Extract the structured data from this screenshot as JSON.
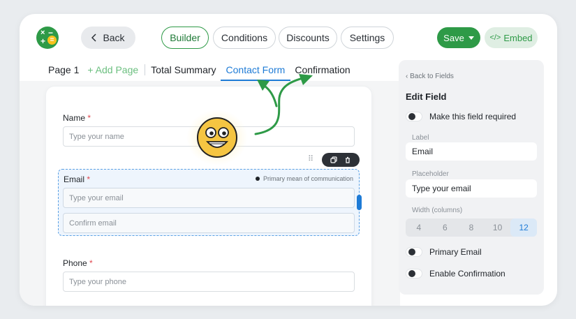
{
  "topbar": {
    "back_label": "Back",
    "tabs": [
      "Builder",
      "Conditions",
      "Discounts",
      "Settings"
    ],
    "save_label": "Save",
    "embed_label": "Embed"
  },
  "pages": {
    "page1": "Page 1",
    "add_page": "+ Add Page",
    "summary": "Total Summary",
    "contact": "Contact Form",
    "confirmation": "Confirmation"
  },
  "form": {
    "name_label": "Name",
    "name_placeholder": "Type your name",
    "email_label": "Email",
    "email_placeholder": "Type your email",
    "confirm_placeholder": "Confirm email",
    "primary_note": "Primary mean of communication",
    "phone_label": "Phone",
    "phone_placeholder": "Type your phone",
    "required_mark": "*"
  },
  "panel": {
    "back": "Back to Fields",
    "title": "Edit Field",
    "required_toggle": "Make this field required",
    "label_caption": "Label",
    "label_value": "Email",
    "placeholder_caption": "Placeholder",
    "placeholder_value": "Type your email",
    "width_caption": "Width (columns)",
    "widths": [
      "4",
      "6",
      "8",
      "10",
      "12"
    ],
    "width_selected": "12",
    "primary_toggle": "Primary Email",
    "confirm_toggle": "Enable Confirmation"
  },
  "colors": {
    "accent_green": "#2e9a47",
    "accent_blue": "#1e7bd6",
    "required_red": "#e0464e"
  }
}
